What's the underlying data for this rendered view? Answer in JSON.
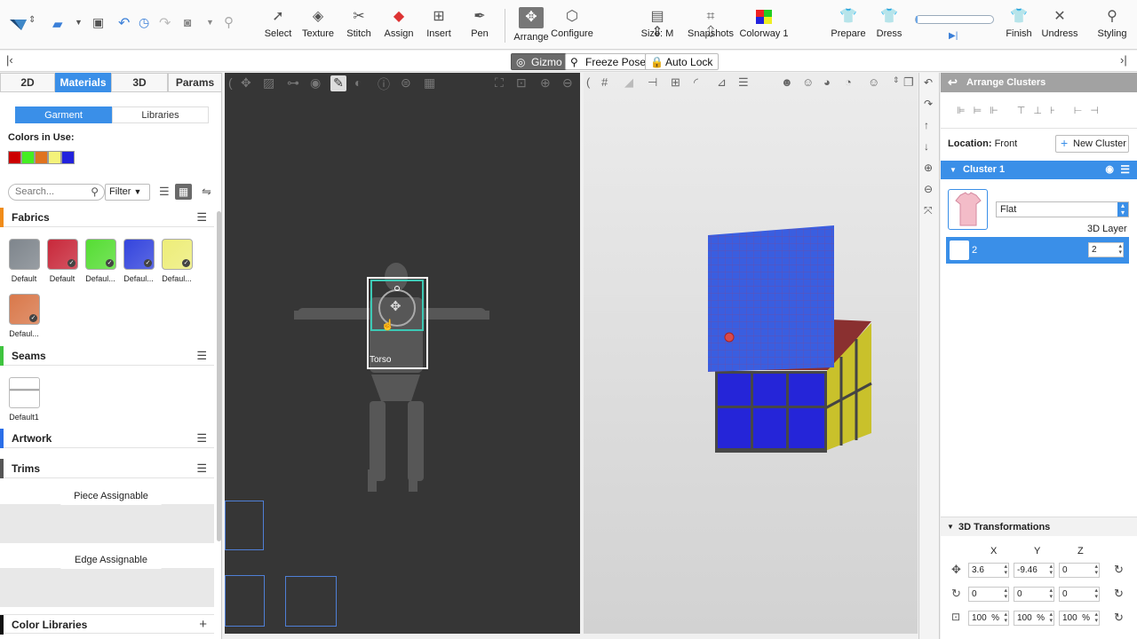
{
  "toolbar": {
    "tools": [
      {
        "label": "Select",
        "icon": "select-arrow-icon"
      },
      {
        "label": "Texture",
        "icon": "texture-icon"
      },
      {
        "label": "Stitch",
        "icon": "stitch-icon"
      },
      {
        "label": "Assign",
        "icon": "assign-icon"
      },
      {
        "label": "Insert",
        "icon": "insert-icon"
      },
      {
        "label": "Pen",
        "icon": "pen-icon"
      },
      {
        "label": "Arrange",
        "icon": "arrange-icon"
      },
      {
        "label": "Configure",
        "icon": "configure-icon"
      }
    ],
    "size_label": "Size: M",
    "snapshots_label": "Snapshots",
    "colorway_label": "Colorway 1",
    "prepare_label": "Prepare",
    "dress_label": "Dress",
    "finish_label": "Finish",
    "undress_label": "Undress",
    "styling_label": "Styling",
    "progress": 0.02
  },
  "bar2": {
    "gizmo": "Gizmo",
    "freeze": "Freeze Pose",
    "autolock": "Auto Lock"
  },
  "left": {
    "tabs": [
      "2D",
      "Materials",
      "3D",
      "Params"
    ],
    "active_tab": "Materials",
    "segments": [
      "Garment",
      "Libraries"
    ],
    "colors_in_use_label": "Colors in Use:",
    "colors": [
      "#cc0000",
      "#44ee22",
      "#e0731f",
      "#f4f27a",
      "#2222dd"
    ],
    "search_placeholder": "Search...",
    "filter_label": "Filter",
    "fabrics_label": "Fabrics",
    "fabrics": [
      {
        "name": "Default",
        "color": "#7e858c"
      },
      {
        "name": "Default",
        "color": "#c8283a"
      },
      {
        "name": "Defaul...",
        "color": "#55dd33"
      },
      {
        "name": "Defaul...",
        "color": "#3344dd"
      },
      {
        "name": "Defaul...",
        "color": "#eded78"
      },
      {
        "name": "Defaul...",
        "color": "#d9784a"
      }
    ],
    "seams_label": "Seams",
    "seam_item": "Default1",
    "artwork_label": "Artwork",
    "trims_label": "Trims",
    "piece_assignable": "Piece Assignable",
    "edge_assignable": "Edge Assignable",
    "color_libraries": "Color Libraries",
    "section_colors": {
      "fabrics": "#f08c1a",
      "seams": "#3fc43f",
      "artwork": "#2a6ee8",
      "trims": "#555555",
      "color_libraries": "#111111"
    }
  },
  "view2d": {
    "torso_label": "Torso"
  },
  "right": {
    "header": "Arrange Clusters",
    "location_label": "Location:",
    "location_value": "Front",
    "new_cluster": "New Cluster",
    "cluster_name": "Cluster 1",
    "flat_value": "Flat",
    "layer_label": "3D Layer",
    "layer_row_label": "2",
    "layer_value": "2",
    "transform_label": "3D Transformations",
    "axes": [
      "X",
      "Y",
      "Z"
    ],
    "position": [
      "3.6",
      "-9.46",
      "0"
    ],
    "rotation": [
      "0",
      "0",
      "0"
    ],
    "scale": [
      "100",
      "100",
      "100"
    ],
    "unit": "%"
  }
}
